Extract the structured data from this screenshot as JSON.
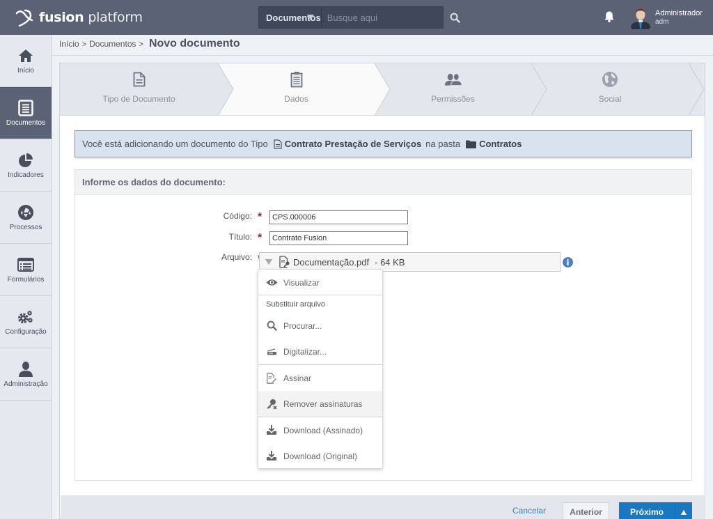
{
  "app": {
    "brand_bold": "fusion",
    "brand_light": "platform"
  },
  "search": {
    "scope": "Documentos",
    "placeholder": "Busque aqui",
    "value": ""
  },
  "user": {
    "name": "Administrador",
    "login": "adm"
  },
  "sidebar": {
    "items": [
      {
        "label": "Início",
        "icon": "home-icon",
        "active": false
      },
      {
        "label": "Documentos",
        "icon": "document-icon",
        "active": true
      },
      {
        "label": "Indicadores",
        "icon": "pie-chart-icon",
        "active": false
      },
      {
        "label": "Processos",
        "icon": "aperture-icon",
        "active": false
      },
      {
        "label": "Formulários",
        "icon": "form-list-icon",
        "active": false
      },
      {
        "label": "Configuração",
        "icon": "gears-icon",
        "active": false
      },
      {
        "label": "Administração",
        "icon": "user-icon",
        "active": false
      }
    ]
  },
  "breadcrumb": {
    "items": [
      "Início",
      "Documentos"
    ],
    "separator": ">",
    "current": "Novo documento"
  },
  "wizard": {
    "steps": [
      {
        "label": "Tipo de Documento",
        "icon": "file-text-icon",
        "state": "done"
      },
      {
        "label": "Dados",
        "icon": "clipboard-icon",
        "state": "active"
      },
      {
        "label": "Permissões",
        "icon": "users-icon",
        "state": "pending"
      },
      {
        "label": "Social",
        "icon": "globe-icon",
        "state": "pending"
      }
    ]
  },
  "info": {
    "prefix": "Você está adicionando um documento do Tipo",
    "doc_type": "Contrato Prestação de Serviços",
    "middle": "na pasta",
    "folder": "Contratos"
  },
  "form": {
    "title": "Informe os dados do documento:",
    "fields": {
      "codigo": {
        "label": "Código:",
        "value": "CPS.000006",
        "required": true
      },
      "titulo": {
        "label": "Título:",
        "value": "Contrato Fusion",
        "required": true
      },
      "arquivo": {
        "label": "Arquivo:",
        "filename": "Documentação.pdf",
        "size": "- 64 KB",
        "required": true
      }
    },
    "required_mark": "*"
  },
  "file_menu": {
    "items": [
      {
        "label": "Visualizar",
        "icon": "eye-icon"
      },
      {
        "header": "Substituir arquivo"
      },
      {
        "label": "Procurar...",
        "icon": "search-icon"
      },
      {
        "label": "Digitalizar...",
        "icon": "scanner-icon"
      },
      {
        "label": "Assinar",
        "icon": "sign-file-icon"
      },
      {
        "label": "Remover assinaturas",
        "icon": "remove-signature-icon",
        "hovered": true
      },
      {
        "label": "Download (Assinado)",
        "icon": "download-icon"
      },
      {
        "label": "Download (Original)",
        "icon": "download-icon"
      }
    ]
  },
  "footer": {
    "cancel": "Cancelar",
    "previous": "Anterior",
    "next": "Próximo"
  },
  "colors": {
    "topbar": "#5b6275",
    "primary": "#1a78c2",
    "link": "#3782c4",
    "required": "#8b2a2a",
    "info_bg": "#d9e3ef"
  }
}
